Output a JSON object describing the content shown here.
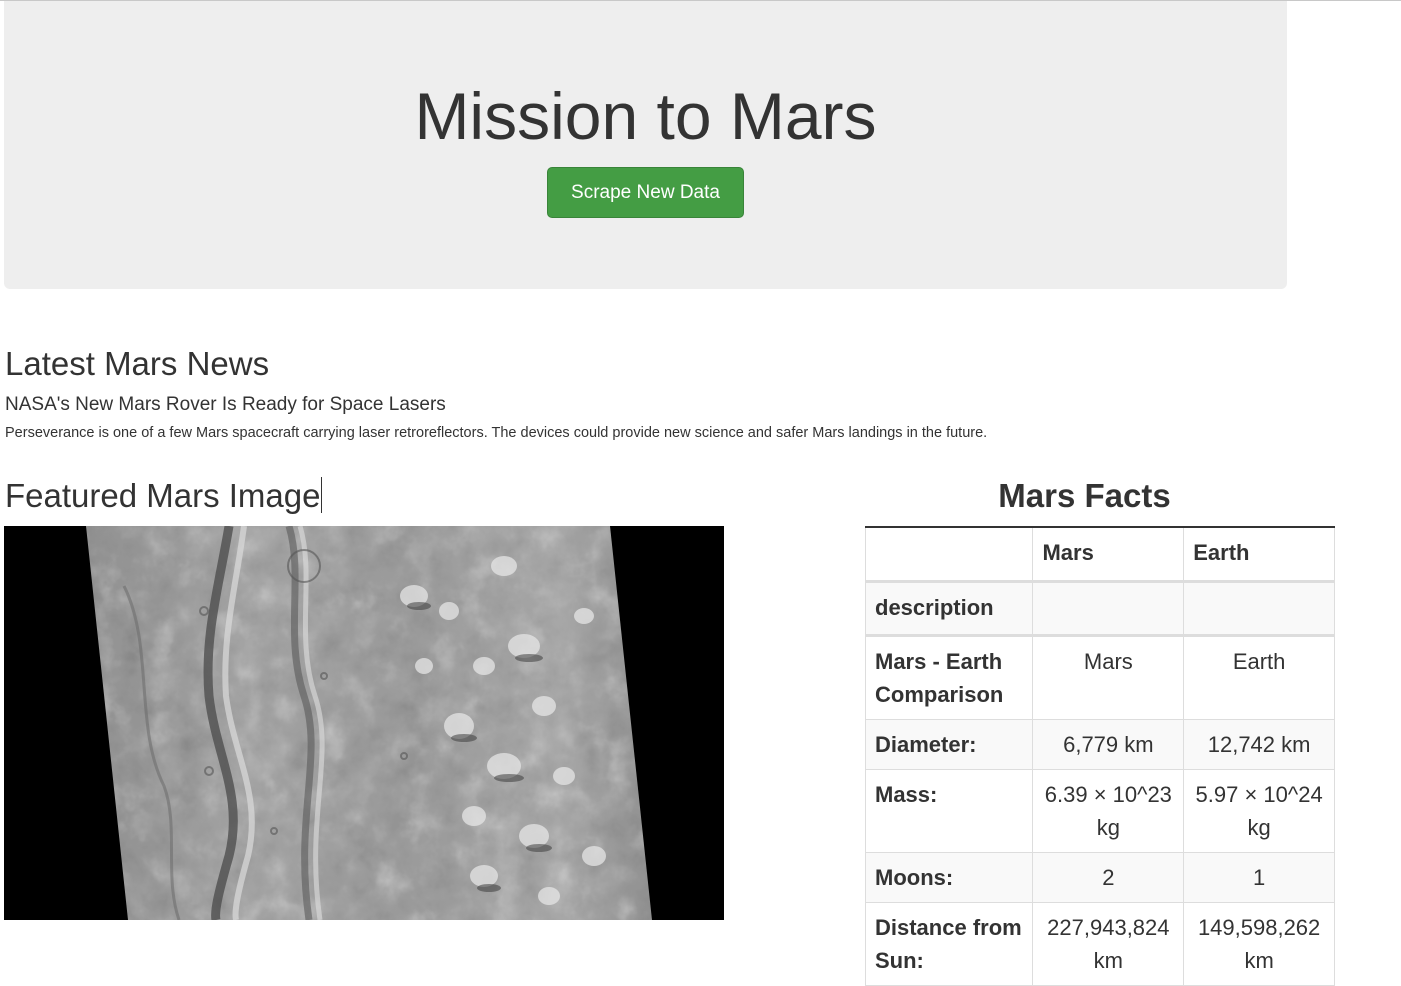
{
  "header": {
    "title": "Mission to Mars",
    "scrape_button": "Scrape New Data"
  },
  "news": {
    "heading": "Latest Mars News",
    "title": "NASA's New Mars Rover Is Ready for Space Lasers",
    "teaser": "Perseverance is one of a few Mars spacecraft carrying laser retroreflectors. The devices could provide new science and safer Mars landings in the future."
  },
  "featured": {
    "heading": "Featured Mars Image"
  },
  "facts": {
    "heading": "Mars Facts",
    "columns": [
      "",
      "Mars",
      "Earth"
    ],
    "rows": [
      {
        "label": "description",
        "mars": "",
        "earth": ""
      },
      {
        "label": "Mars - Earth Comparison",
        "mars": "Mars",
        "earth": "Earth"
      },
      {
        "label": "Diameter:",
        "mars": "6,779 km",
        "earth": "12,742 km"
      },
      {
        "label": "Mass:",
        "mars": "6.39 × 10^23 kg",
        "earth": "5.97 × 10^24 kg"
      },
      {
        "label": "Moons:",
        "mars": "2",
        "earth": "1"
      },
      {
        "label": "Distance from Sun:",
        "mars": "227,943,824 km",
        "earth": "149,598,262 km"
      }
    ]
  }
}
